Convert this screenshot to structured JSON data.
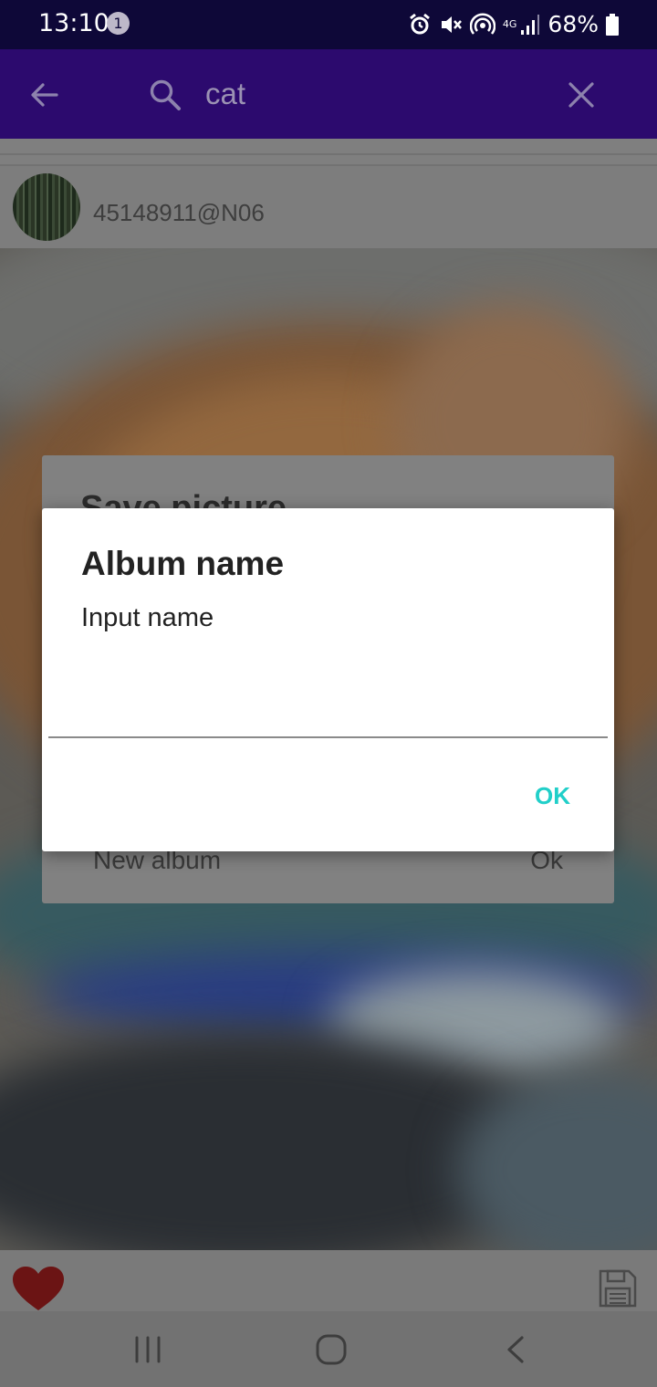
{
  "status_bar": {
    "time": "13:10",
    "notification_count": "1",
    "network_type": "4G",
    "battery": "68%"
  },
  "app_bar": {
    "search_query": "cat",
    "icons": [
      "arrow-back-icon",
      "search-icon",
      "close-icon"
    ]
  },
  "post": {
    "user_id": "45148911@N06"
  },
  "background_dialog": {
    "title": "Save picture",
    "new_album_label": "New album",
    "ok_label": "Ok"
  },
  "dialog": {
    "title": "Album name",
    "message": "Input name",
    "input_value": "",
    "ok_label": "OK"
  },
  "action_bar": {
    "icons": [
      "heart-icon",
      "floppy-disk-icon"
    ]
  },
  "colors": {
    "status_bar": "#0e0838",
    "app_bar": "#2c0a6e",
    "accent": "#21cfc9",
    "heart": "#6b1414"
  }
}
